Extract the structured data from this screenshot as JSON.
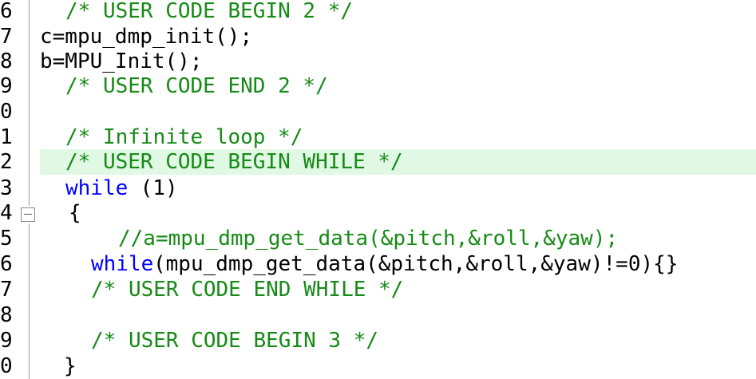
{
  "colors": {
    "comment": "#168a16",
    "keyword": "#0000ff",
    "text": "#000000",
    "highlight": "#e1f8e5"
  },
  "lines": [
    {
      "num": "6",
      "parts": [
        {
          "t": "/* USER CODE BEGIN 2 */",
          "k": "comment"
        }
      ]
    },
    {
      "num": "7",
      "parts": [
        {
          "t": "c=mpu_dmp_init();",
          "k": "normal"
        }
      ]
    },
    {
      "num": "8",
      "parts": [
        {
          "t": "b=MPU_Init();",
          "k": "normal"
        }
      ]
    },
    {
      "num": "9",
      "parts": [
        {
          "t": "/* USER CODE END 2 */",
          "k": "comment"
        }
      ]
    },
    {
      "num": "0",
      "parts": []
    },
    {
      "num": "1",
      "parts": [
        {
          "t": "/* Infinite loop */",
          "k": "comment"
        }
      ]
    },
    {
      "num": "2",
      "parts": [
        {
          "t": "/* USER CODE BEGIN WHILE */",
          "k": "comment"
        }
      ]
    },
    {
      "num": "3",
      "parts": [
        {
          "t": "while",
          "k": "keyword"
        },
        {
          "t": " (1)",
          "k": "normal"
        }
      ]
    },
    {
      "num": "4",
      "parts": [
        {
          "t": "{",
          "k": "normal"
        }
      ]
    },
    {
      "num": "5",
      "parts": [
        {
          "t": "//a=mpu_dmp_get_data(&pitch,&roll,&yaw);",
          "k": "comment"
        }
      ]
    },
    {
      "num": "6",
      "parts": [
        {
          "t": "while",
          "k": "keyword"
        },
        {
          "t": "(mpu_dmp_get_data(&pitch,&roll,&yaw)!=0){}",
          "k": "normal"
        }
      ]
    },
    {
      "num": "7",
      "parts": [
        {
          "t": "/* USER CODE END WHILE */",
          "k": "comment"
        }
      ]
    },
    {
      "num": "8",
      "parts": []
    },
    {
      "num": "9",
      "parts": [
        {
          "t": "/* USER CODE BEGIN 3 */",
          "k": "comment"
        }
      ]
    },
    {
      "num": "0",
      "parts": [
        {
          "t": "}",
          "k": "normal"
        }
      ]
    }
  ]
}
